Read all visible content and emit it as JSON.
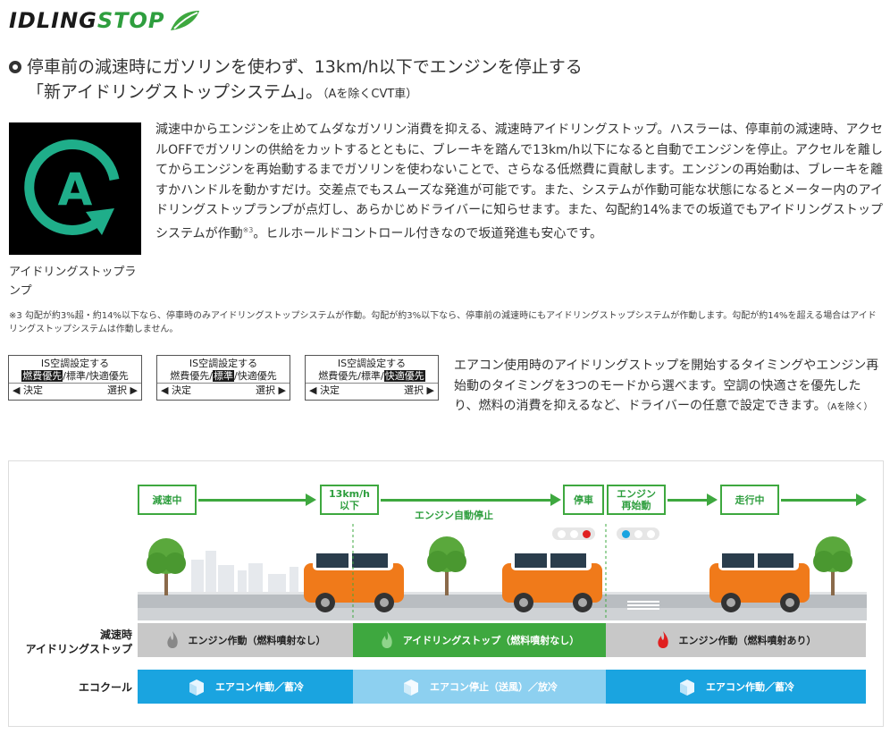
{
  "logo": {
    "part1": "IDLING",
    "part2": "STOP"
  },
  "headline": {
    "line1": "停車前の減速時にガソリンを使わず、13km/h以下でエンジンを停止する",
    "line2_main": "「新アイドリングストップシステム」。",
    "line2_note": "（Aを除くCVT車）"
  },
  "lamp": {
    "symbol": "A",
    "caption": "アイドリングストップランプ",
    "icon": "idling-stop-lamp-icon"
  },
  "body_text": {
    "part1": "減速中からエンジンを止めてムダなガソリン消費を抑える、減速時アイドリングストップ。ハスラーは、停車前の減速時、アクセルOFFでガソリンの供給をカットするとともに、ブレーキを踏んで13km/h以下になると自動でエンジンを停止。アクセルを離してからエンジンを再始動するまでガソリンを使わないことで、さらなる低燃費に貢献します。エンジンの再始動は、ブレーキを離すかハンドルを動かすだけ。交差点でもスムーズな発進が可能です。また、システムが作動可能な状態になるとメーター内のアイドリングストップランプが点灯し、あらかじめドライバーに知らせます。また、勾配約14%までの坂道でもアイドリングストップシステムが作動",
    "sup": "※3",
    "part2": "。ヒルホールドコントロール付きなので坂道発進も安心です。"
  },
  "footnote": "※3 勾配が約3%超・約14%以下なら、停車時のみアイドリングストップシステムが作動。勾配が約3%以下なら、停車前の減速時にもアイドリングストップシステムが作動します。勾配が約14%を超える場合はアイドリングストップシステムは作動しません。",
  "panels": [
    {
      "title": "IS空調設定する",
      "opt1": "燃費優先",
      "sep1": "/",
      "opt2": "標準",
      "sep2": "/",
      "opt3": "快適優先",
      "selected": 1,
      "nav_left": "◀ 決定",
      "nav_right": "選択 ▶"
    },
    {
      "title": "IS空調設定する",
      "opt1": "燃費優先",
      "sep1": "/",
      "opt2": "標準",
      "sep2": "/",
      "opt3": "快適優先",
      "selected": 2,
      "nav_left": "◀ 決定",
      "nav_right": "選択 ▶"
    },
    {
      "title": "IS空調設定する",
      "opt1": "燃費優先",
      "sep1": "/",
      "opt2": "標準",
      "sep2": "/",
      "opt3": "快適優先",
      "selected": 3,
      "nav_left": "◀ 決定",
      "nav_right": "選択 ▶"
    }
  ],
  "ac_text": {
    "main": "エアコン使用時のアイドリングストップを開始するタイミングやエンジン再始動のタイミングを3つのモードから選べます。空調の快適さを優先したり、燃料の消費を抑えるなど、ドライバーの任意で設定できます。",
    "note": "（Aを除く）"
  },
  "diagram": {
    "stages": [
      "減速中",
      "13km/h\n以下",
      "停車",
      "エンジン\n再始動",
      "走行中"
    ],
    "auto_stop": "エンジン自動停止",
    "row1_label": "減速時\nアイドリングストップ",
    "row2_label": "エコクール",
    "row1_bands": [
      "エンジン作動（燃料噴射なし）",
      "アイドリングストップ（燃料噴射なし）",
      "エンジン作動（燃料噴射あり）"
    ],
    "row2_bands": [
      "エアコン作動／蓄冷",
      "エアコン停止（送風）／放冷",
      "エアコン作動／蓄冷"
    ],
    "colors": {
      "green": "#3ea83f",
      "gray": "#c8c8c8",
      "blue": "#1aa4e0",
      "lightblue": "#8dd0f0",
      "orange": "#f07a1a",
      "flame_red": "#e02020"
    }
  }
}
